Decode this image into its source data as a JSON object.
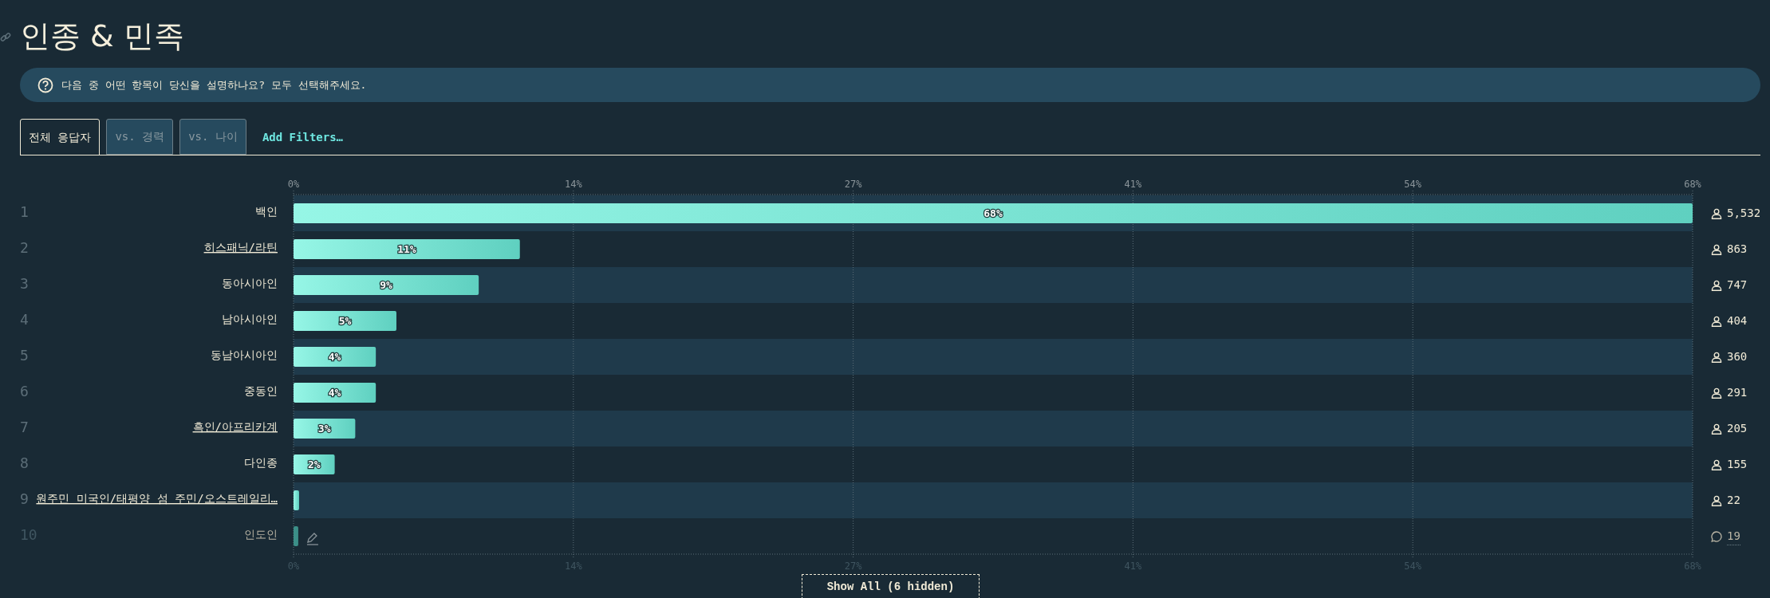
{
  "title": "인종 & 민족",
  "question": "다음 중 어떤 항목이 당신을 설명하나요? 모두 선택해주세요.",
  "tabs": [
    {
      "label": "전체 응답자",
      "selected": true
    },
    {
      "label": "vs. 경력",
      "selected": false
    },
    {
      "label": "vs. 나이",
      "selected": false
    }
  ],
  "add_filters": "Add Filters…",
  "chart_data": {
    "type": "bar",
    "orientation": "horizontal",
    "categories": [
      "백인",
      "히스패닉/라틴",
      "동아시아인",
      "남아시아인",
      "동남아시아인",
      "중동인",
      "흑인/아프리카계",
      "다인종",
      "원주민 미국인/태평양 섬 주민/오스트레일리…",
      "인도인"
    ],
    "values": [
      68,
      11,
      9,
      5,
      4,
      4,
      3,
      2,
      0.27,
      0.23
    ],
    "grid": true,
    "xlim": [
      0,
      68
    ],
    "xticks": [
      {
        "value": 0,
        "label": "0%"
      },
      {
        "value": 13.6,
        "label": "14%"
      },
      {
        "value": 27.2,
        "label": "27%"
      },
      {
        "value": 40.8,
        "label": "41%"
      },
      {
        "value": 54.4,
        "label": "54%"
      },
      {
        "value": 68,
        "label": "68%"
      }
    ],
    "value_labels": [
      "68%",
      "11%",
      "9%",
      "5%",
      "4%",
      "4%",
      "3%",
      "2%",
      null,
      null
    ]
  },
  "rows": [
    {
      "rank": "1",
      "count": "5,532",
      "kind": "option",
      "underlined": false
    },
    {
      "rank": "2",
      "count": "863",
      "kind": "option",
      "underlined": true
    },
    {
      "rank": "3",
      "count": "747",
      "kind": "option",
      "underlined": false
    },
    {
      "rank": "4",
      "count": "404",
      "kind": "option",
      "underlined": false
    },
    {
      "rank": "5",
      "count": "360",
      "kind": "option",
      "underlined": false
    },
    {
      "rank": "6",
      "count": "291",
      "kind": "option",
      "underlined": false
    },
    {
      "rank": "7",
      "count": "205",
      "kind": "option",
      "underlined": true
    },
    {
      "rank": "8",
      "count": "155",
      "kind": "option",
      "underlined": false
    },
    {
      "rank": "9",
      "count": "22",
      "kind": "option",
      "underlined": true
    },
    {
      "rank": "10",
      "count": "19",
      "kind": "write_in",
      "underlined": false
    }
  ],
  "show_all": "Show All (6 hidden)"
}
